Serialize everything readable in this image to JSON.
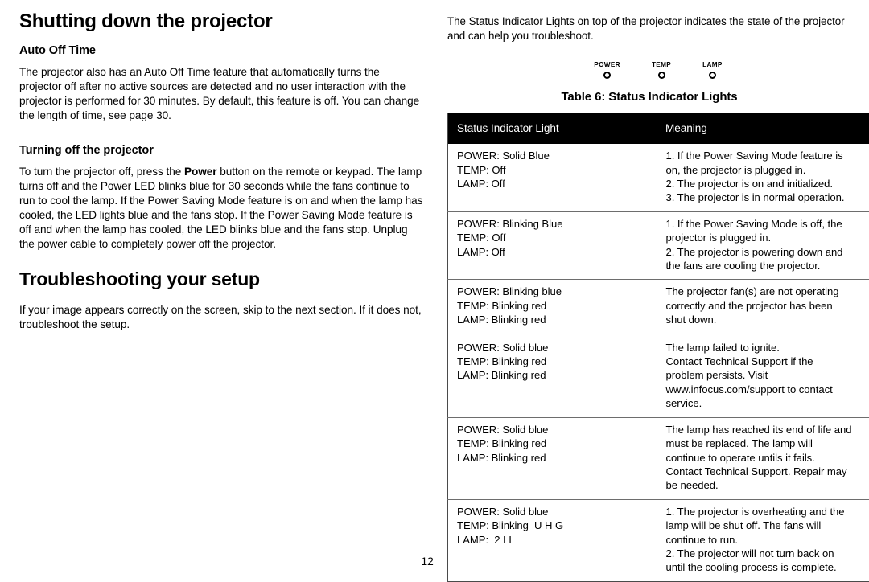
{
  "left_column": {
    "heading_1": "Shutting down the projector",
    "subheading_1": "Auto Off Time",
    "paragraph_1": "The projector also has an Auto Off Time feature that automatically turns the projector off after no active sources are detected and no user interaction with the projector is performed for 30 minutes. By default, this feature is off. You can change the length of time, see page 30.",
    "subheading_2": "Turning off the projector",
    "paragraph_2_part1": "To turn the projector off, press the ",
    "paragraph_2_bold": "Power",
    "paragraph_2_part2": " button on the remote or keypad. The lamp turns off and the Power LED blinks blue for 30 seconds while the fans continue to run to cool the lamp. If the Power Saving Mode feature is on and when the lamp has cooled, the LED lights blue and the fans stop. If the Power Saving Mode feature is off and when the lamp has cooled, the LED blinks blue and the fans stop. Unplug the power cable to completely power off the projector.",
    "heading_2": "Troubleshooting your setup",
    "paragraph_3": "If your image appears correctly on the screen, skip to the next section. If it does not, troubleshoot the setup."
  },
  "right_column": {
    "intro": "The Status Indicator Lights on top of the projector indicates the state of the projector and can help you troubleshoot.",
    "led_indicators": [
      {
        "label": "POWER"
      },
      {
        "label": "TEMP"
      },
      {
        "label": "LAMP"
      }
    ],
    "table_caption": "Table 6: Status Indicator Lights",
    "table": {
      "headers": [
        "Status Indicator Light",
        "Meaning"
      ],
      "rows": [
        {
          "status_blocks": [
            [
              "POWER: Solid Blue",
              "TEMP: Off",
              "LAMP: Off"
            ]
          ],
          "meaning_blocks": [
            [
              "1. If the Power Saving Mode feature is",
              "on, the projector is plugged in.",
              "2. The projector is on and initialized.",
              "3. The projector is in normal operation."
            ]
          ]
        },
        {
          "status_blocks": [
            [
              "POWER: Blinking Blue",
              "TEMP: Off",
              "LAMP: Off"
            ]
          ],
          "meaning_blocks": [
            [
              "1. If the Power Saving Mode is off, the",
              "projector is plugged in.",
              "2. The projector is powering down and",
              "the fans are cooling the projector."
            ]
          ]
        },
        {
          "status_blocks": [
            [
              "POWER: Blinking blue",
              "TEMP: Blinking red",
              "LAMP: Blinking red"
            ],
            [
              "POWER: Solid blue",
              "TEMP: Blinking red",
              "LAMP: Blinking red"
            ]
          ],
          "meaning_blocks": [
            [
              "The projector fan(s) are not operating",
              "correctly and the projector has been",
              "shut down."
            ],
            [
              "The lamp failed to ignite.",
              "Contact Technical Support if the",
              "problem persists. Visit",
              "www.infocus.com/support to contact",
              "service."
            ]
          ]
        },
        {
          "status_blocks": [
            [
              "POWER: Solid blue",
              "TEMP: Blinking red",
              "LAMP: Blinking red"
            ]
          ],
          "meaning_blocks": [
            [
              "The lamp has reached its end of life and",
              "must be replaced. The lamp will",
              "continue to operate untils it fails.",
              "Contact Technical Support. Repair may",
              "be needed."
            ]
          ]
        },
        {
          "status_blocks": [
            [
              "POWER: Solid blue",
              "TEMP: Blinking  U H G",
              "LAMP:  2 I I"
            ]
          ],
          "meaning_blocks": [
            [
              "1. The projector is overheating and the",
              "lamp will be shut off. The fans will",
              "continue to run.",
              "2. The projector will not turn back on",
              "until the cooling process is complete."
            ]
          ]
        }
      ]
    }
  },
  "footer": {
    "page_number": "12"
  },
  "colors": {
    "header_background": "#000000",
    "header_text": "#ffffff",
    "body_text": "#000000",
    "table_border": "#6d6d6d",
    "page_background": "#ffffff"
  }
}
